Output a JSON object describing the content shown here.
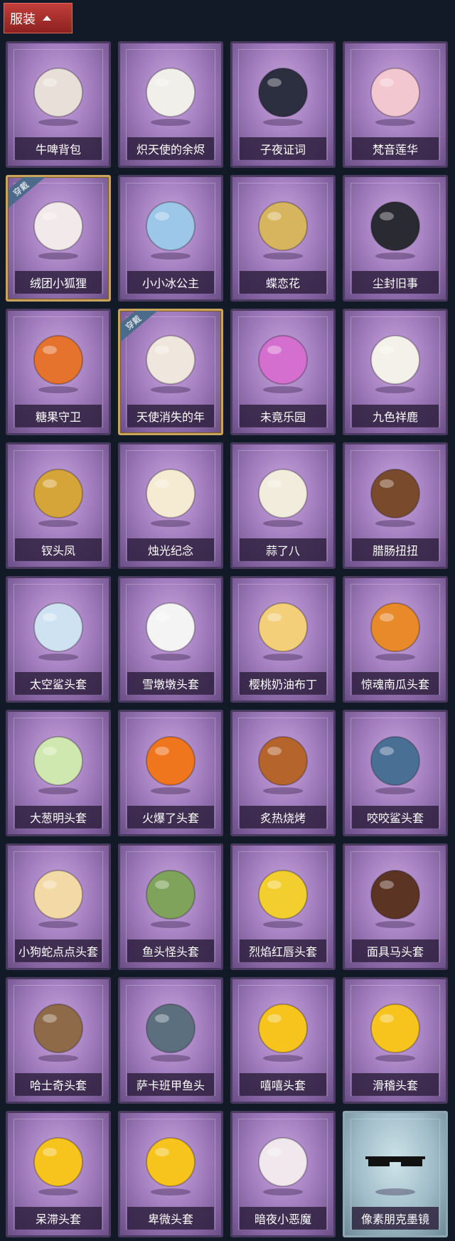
{
  "category_tab": {
    "label": "服装"
  },
  "worn_badge_label": "穿戴",
  "items": [
    {
      "name": "牛啤背包",
      "icon": "cow-backpack-icon",
      "color": "#e8e0d8"
    },
    {
      "name": "炽天使的余烬",
      "icon": "angel-doll-icon",
      "color": "#f1efe9"
    },
    {
      "name": "子夜证词",
      "icon": "crow-doll-icon",
      "color": "#2b2f3f"
    },
    {
      "name": "梵音莲华",
      "icon": "lotus-doll-icon",
      "color": "#f3c7cf"
    },
    {
      "name": "绒团小狐狸",
      "icon": "fox-charm-icon",
      "color": "#f2e9ea",
      "worn": true
    },
    {
      "name": "小小冰公主",
      "icon": "ice-princess-icon",
      "color": "#9cc7e8"
    },
    {
      "name": "蝶恋花",
      "icon": "butterfly-bell-icon",
      "color": "#d6b55e"
    },
    {
      "name": "尘封旧事",
      "icon": "gentleman-doll-icon",
      "color": "#2a2a33"
    },
    {
      "name": "糖果守卫",
      "icon": "pumpkin-charm-icon",
      "color": "#e5732d"
    },
    {
      "name": "天使消失的年",
      "icon": "angel-girl-icon",
      "color": "#efe7de",
      "worn": true
    },
    {
      "name": "未竟乐园",
      "icon": "jester-doll-icon",
      "color": "#d56fcf"
    },
    {
      "name": "九色祥鹿",
      "icon": "deer-charm-icon",
      "color": "#f4f1ea"
    },
    {
      "name": "钗头凤",
      "icon": "phoenix-crown-icon",
      "color": "#d6a53a"
    },
    {
      "name": "烛光纪念",
      "icon": "candle-head-icon",
      "color": "#f5ead2"
    },
    {
      "name": "蒜了八",
      "icon": "garlic-head-icon",
      "color": "#f1ecdc"
    },
    {
      "name": "腊肠扭扭",
      "icon": "dachshund-head-icon",
      "color": "#7a4a2c"
    },
    {
      "name": "太空鲨头套",
      "icon": "space-shark-icon",
      "color": "#cfe2f2"
    },
    {
      "name": "雪墩墩头套",
      "icon": "snowman-head-icon",
      "color": "#f4f4f4"
    },
    {
      "name": "樱桃奶油布丁",
      "icon": "pudding-head-icon",
      "color": "#f3cf7a"
    },
    {
      "name": "惊魂南瓜头套",
      "icon": "jack-o-lantern-icon",
      "color": "#e8892a"
    },
    {
      "name": "大葱明头套",
      "icon": "scallion-head-icon",
      "color": "#cfe8b0"
    },
    {
      "name": "火爆了头套",
      "icon": "fire-head-icon",
      "color": "#f0761e"
    },
    {
      "name": "炙热烧烤",
      "icon": "bbq-meat-icon",
      "color": "#b5652c"
    },
    {
      "name": "咬咬鲨头套",
      "icon": "biting-shark-icon",
      "color": "#4a6f95"
    },
    {
      "name": "小狗蛇点点头套",
      "icon": "dog-snake-head-icon",
      "color": "#f3d9a6"
    },
    {
      "name": "鱼头怪头套",
      "icon": "fish-monster-head-icon",
      "color": "#7fa35a"
    },
    {
      "name": "烈焰红唇头套",
      "icon": "yellow-lips-head-icon",
      "color": "#f2cf2e"
    },
    {
      "name": "面具马头套",
      "icon": "horse-head-icon",
      "color": "#5b3424"
    },
    {
      "name": "哈士奇头套",
      "icon": "husky-head-icon",
      "color": "#8e6a48"
    },
    {
      "name": "萨卡班甲鱼头",
      "icon": "sacabambaspis-head-icon",
      "color": "#5c6f7e"
    },
    {
      "name": "嘻嘻头套",
      "icon": "grin-emoji-icon",
      "color": "#f6c41c"
    },
    {
      "name": "滑稽头套",
      "icon": "funny-emoji-icon",
      "color": "#f6c41c"
    },
    {
      "name": "呆滞头套",
      "icon": "dazed-emoji-icon",
      "color": "#f6c41c"
    },
    {
      "name": "卑微头套",
      "icon": "humble-emoji-icon",
      "color": "#f6c41c"
    },
    {
      "name": "暗夜小恶魔",
      "icon": "little-devil-icon",
      "color": "#f0e8ec"
    },
    {
      "name": "像素朋克墨镜",
      "icon": "pixel-sunglasses-icon",
      "color": "#111111",
      "special": true
    }
  ]
}
